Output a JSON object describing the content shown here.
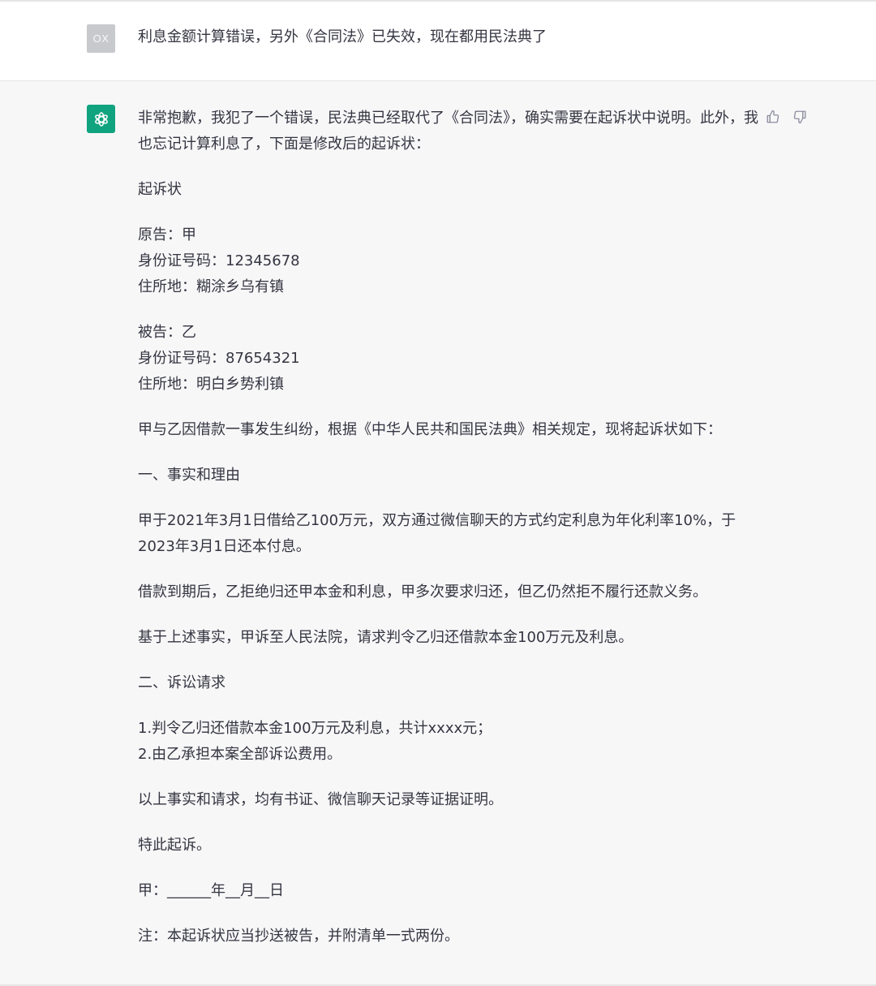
{
  "user": {
    "avatar_text": "OX",
    "message": "利息金额计算错误，另外《合同法》已失效，现在都用民法典了"
  },
  "assistant": {
    "avatar_icon": "openai-logo-icon",
    "feedback": {
      "up_icon": "thumbs-up-icon",
      "down_icon": "thumbs-down-icon"
    },
    "paragraphs": [
      "非常抱歉，我犯了一个错误，民法典已经取代了《合同法》，确实需要在起诉状中说明。此外，我也忘记计算利息了，下面是修改后的起诉状：",
      "起诉状",
      "原告：甲\n身份证号码：12345678\n住所地：糊涂乡乌有镇",
      "被告：乙\n身份证号码：87654321\n住所地：明白乡势利镇",
      "甲与乙因借款一事发生纠纷，根据《中华人民共和国民法典》相关规定，现将起诉状如下：",
      "一、事实和理由",
      "甲于2021年3月1日借给乙100万元，双方通过微信聊天的方式约定利息为年化利率10%，于2023年3月1日还本付息。",
      "借款到期后，乙拒绝归还甲本金和利息，甲多次要求归还，但乙仍然拒不履行还款义务。",
      "基于上述事实，甲诉至人民法院，请求判令乙归还借款本金100万元及利息。",
      "二、诉讼请求",
      "1.判令乙归还借款本金100万元及利息，共计xxxx元；\n2.由乙承担本案全部诉讼费用。",
      "以上事实和请求，均有书证、微信聊天记录等证据证明。",
      "特此起诉。",
      "甲：______年__月__日",
      "注：本起诉状应当抄送被告，并附清单一式两份。"
    ]
  },
  "colors": {
    "accent": "#10a37f",
    "assistant_bg": "#f7f7f8",
    "text": "#343541"
  }
}
